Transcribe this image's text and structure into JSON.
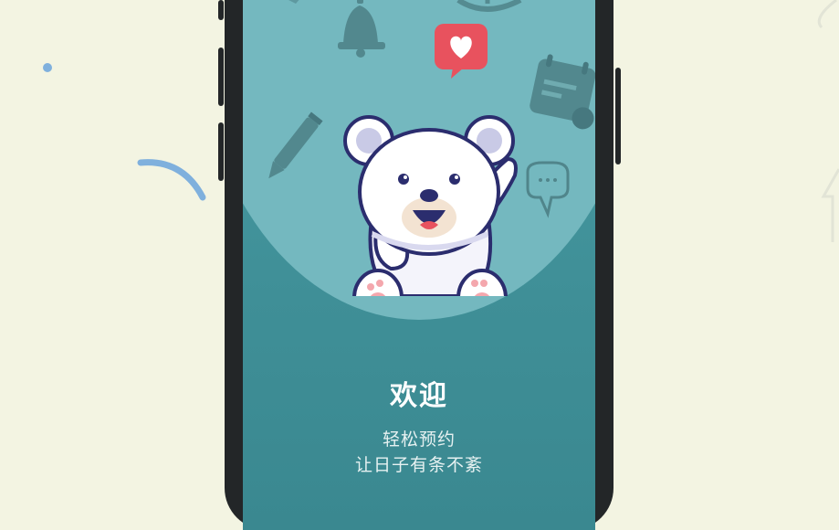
{
  "screen": {
    "title": "欢迎",
    "subtitle_line1": "轻松预约",
    "subtitle_line2": "让日子有条不紊"
  },
  "icons": [
    "bell-icon",
    "clock-icon",
    "calendar-icon",
    "pencil-icon",
    "chat-bubble-icon",
    "heart-bubble-icon",
    "polar-bear-illustration"
  ],
  "colors": {
    "page_background": "#f3f4e2",
    "screen_teal": "#4a9ea5",
    "halo_teal": "#74b8bf",
    "heart_red": "#e8525e",
    "accent_blue": "#7fb0dd"
  }
}
